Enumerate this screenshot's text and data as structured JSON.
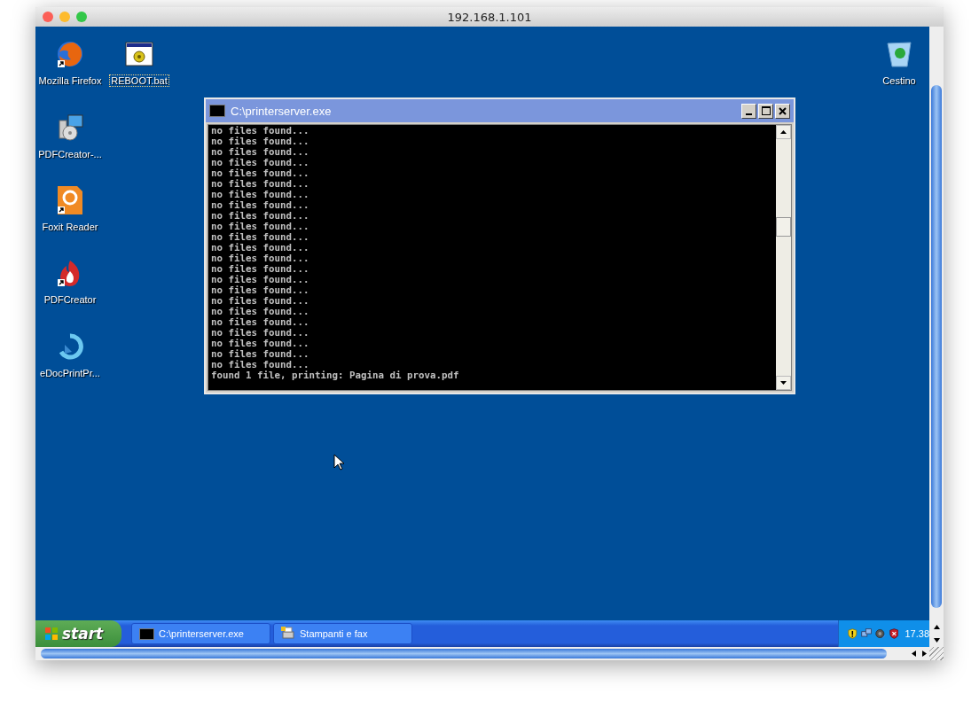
{
  "window": {
    "title": "192.168.1.101"
  },
  "desktop": {
    "icons": [
      {
        "label": "Mozilla Firefox",
        "selected": false
      },
      {
        "label": "REBOOT.bat",
        "selected": true
      },
      {
        "label": "PDFCreator-...",
        "selected": false
      },
      {
        "label": "Foxit Reader",
        "selected": false
      },
      {
        "label": "PDFCreator",
        "selected": false
      },
      {
        "label": "eDocPrintPr...",
        "selected": false
      },
      {
        "label": "Cestino",
        "selected": false
      }
    ]
  },
  "console": {
    "title": "C:\\printerserver.exe",
    "lines": [
      "no files found...",
      "no files found...",
      "no files found...",
      "no files found...",
      "no files found...",
      "no files found...",
      "no files found...",
      "no files found...",
      "no files found...",
      "no files found...",
      "no files found...",
      "no files found...",
      "no files found...",
      "no files found...",
      "no files found...",
      "no files found...",
      "no files found...",
      "no files found...",
      "no files found...",
      "no files found...",
      "no files found...",
      "no files found...",
      "no files found...",
      "found 1 file, printing: Pagina di prova.pdf"
    ]
  },
  "taskbar": {
    "start": "start",
    "tasks": [
      {
        "label": "C:\\printerserver.exe"
      },
      {
        "label": "Stampanti e fax"
      }
    ],
    "clock": "17.38"
  }
}
